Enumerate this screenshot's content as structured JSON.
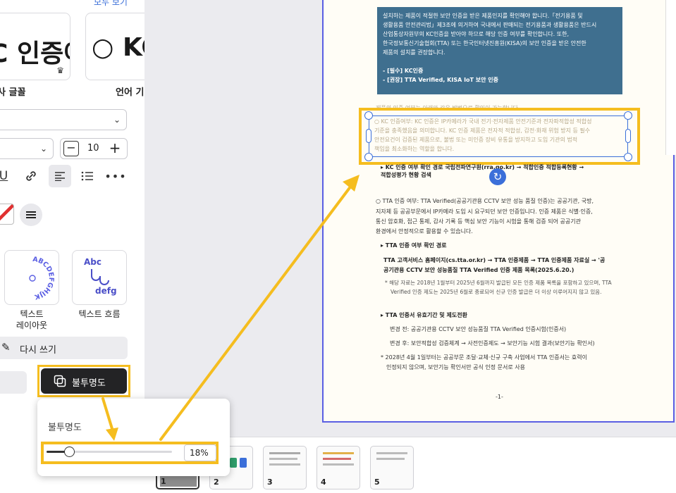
{
  "left_panel": {
    "show_all_link": "모두 보기",
    "font_cards": [
      {
        "sample": "C 인증여",
        "label": "사 글꼴"
      },
      {
        "sample": "○ KC",
        "label": "언어 기"
      }
    ],
    "font_select_value": "",
    "font_size_value": "10",
    "effects": [
      {
        "ring_text": "ABCDEFGHIJK",
        "label_line1": "텍스트",
        "label_line2": "레이아웃"
      },
      {
        "flow_top": "Abc",
        "flow_bottom": "defg",
        "label": "텍스트 흐름"
      }
    ],
    "rewrite_label": "다시 쓰기",
    "opacity_button_label": "불투명도"
  },
  "document": {
    "blue_box_lines": [
      "설치하는 제품이 적절한 보안 인증을 받은 제품인지를 확인해야 합니다.「전기용품 및",
      "생활용품 안전관리법」제3조에 의거하여 국내에서 판매되는 전기용품과 생활용품은 반드시",
      "산업통상자원부의 KC인증을 받아야 하므로 해당 인증 여부를 확인합니다. 또한,",
      "한국정보통신기술협회(TTA) 또는 한국인터넷진흥원(KISA)의 보안 인증을 받은 안전한",
      "제품의 설치를 권장합니다.",
      "",
      " - [필수] KC인증",
      " - [권장] TTA Verified, KISA IoT 보안 인증"
    ],
    "check_line": "제품의 인증 여부는 아래와 같은 방법으로 확인이 가능합니다.",
    "selected_lines": [
      "○ KC 인증여부: KC 인증은 IP카메라가 국내 전기·전자제품 안전기준과 전자파적합성 적합성",
      "기준을 충족했음을 의미합니다. KC 인증 제품은 전자적 적합성, 감전·화재 위험 방지 등 필수",
      "안전요건이 검증된 제품으로, 불법 또는 미인증 장비 유통을 방지하고 도입 기관의 법적",
      "책임을 최소화하는 역할을 합니다."
    ],
    "kc_path_line1": "▸ KC 인증 여부 확인 경로 국립전파연구원(rra.go.kr) → 적합인증 적합등록현황 →",
    "kc_path_line2": "적합성평가 현황 검색",
    "tta_para": [
      "○ TTA 인증 여부: TTA Verified(공공기관용 CCTV 보안 성능 품질 인증)는 공공기관, 국방,",
      "지자체 등 공공부문에서 IP카메라 도입 시 요구되던 보안 인증입니다. 인증 제품은 식별·인증,",
      "통신 암호화, 접근 통제, 감사 기록 등 핵심 보안 기능이 시험을 통해 검증 되어 공공기관",
      "환경에서 안정적으로 활용할 수 있습니다."
    ],
    "tta_path_title": "▸ TTA 인증 여부 확인 경로",
    "tta_path_lines": [
      "TTA 고객서비스 홈페이지(cs.tta.or.kr) → TTA 인증제품 → TTA 인증제품 자료실 → '공",
      "공기관용 CCTV 보안 성능품질 TTA Verified 인증 제품 목록(2025.6.20.)"
    ],
    "tta_note": [
      "* 해당 자료는 2018년 1월부터 2025년 6월까지 발급된 모든 인증 제품 목록을 포함하고 있으며, TTA",
      "Verified 인증 제도는 2025년 6월로 종료되어 신규 인증 발급은 더 이상 이루어지지 않고 있음."
    ],
    "transition_title": "▸ TTA 인증서 유효기간 및 제도전환",
    "before_line": "변경 전: 공공기관용 CCTV 보안 성능품질 TTA Verified 인증시험(인증서)",
    "after_line": "변경 후: 보안적합성 검증체계 → 사전인증제도 → 보안기능 시험 결과(보안기능 확인서)",
    "final_note": [
      "* 2028년 4월 1일부터는 공공부문 조달·교체·신규 구축 사업에서 TTA 인증서는 효력이",
      "인정되지 않으며, 보안기능 확인서만 공식 인정 문서로 사용"
    ],
    "page_footer": "-1-"
  },
  "thumbnails": [
    {
      "num": "1"
    },
    {
      "num": "2"
    },
    {
      "num": "3"
    },
    {
      "num": "4"
    },
    {
      "num": "5"
    }
  ],
  "opacity_popup": {
    "title": "불투명도",
    "value_text": "18%",
    "level_percent": 18
  },
  "colors": {
    "accent": "#f5bd1f",
    "selection": "#3b6fd9",
    "page_border": "#5a5ee3",
    "blue_box": "#3f6f8f",
    "dark_button": "#232325"
  }
}
